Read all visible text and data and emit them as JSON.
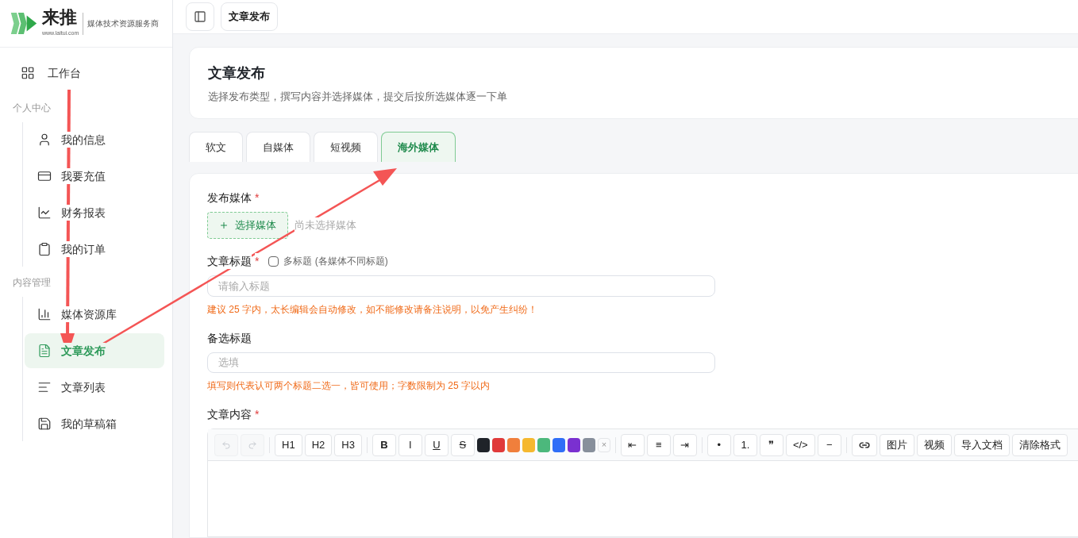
{
  "logo": {
    "name": "来推",
    "url": "www.laitui.com",
    "tagline": "媒体技术资源服务商"
  },
  "header": {
    "breadcrumb": "文章发布"
  },
  "sidebar": {
    "top": {
      "label": "工作台",
      "selected": false
    },
    "groups": [
      {
        "title": "个人中心",
        "items": [
          {
            "label": "我的信息",
            "selected": false
          },
          {
            "label": "我要充值",
            "selected": false
          },
          {
            "label": "财务报表",
            "selected": false
          },
          {
            "label": "我的订单",
            "selected": false
          }
        ]
      },
      {
        "title": "内容管理",
        "items": [
          {
            "label": "媒体资源库",
            "selected": false
          },
          {
            "label": "文章发布",
            "selected": true
          },
          {
            "label": "文章列表",
            "selected": false
          },
          {
            "label": "我的草稿箱",
            "selected": false
          }
        ]
      }
    ]
  },
  "page": {
    "title": "文章发布",
    "subtitle": "选择发布类型，撰写内容并选择媒体，提交后按所选媒体逐一下单"
  },
  "tabs": [
    {
      "label": "软文",
      "selected": false
    },
    {
      "label": "自媒体",
      "selected": false
    },
    {
      "label": "短视频",
      "selected": false
    },
    {
      "label": "海外媒体",
      "selected": true
    }
  ],
  "form": {
    "media": {
      "label": "发布媒体",
      "required_mark": "*",
      "button": "选择媒体",
      "status": "尚未选择媒体"
    },
    "title": {
      "label": "文章标题",
      "required_mark": "*",
      "checkbox": {
        "label": "多标题",
        "note": "(各媒体不同标题)",
        "checked": false
      },
      "placeholder": "请输入标题",
      "hint": "建议 25 字内，太长编辑会自动修改，如不能修改请备注说明，以免产生纠纷！"
    },
    "alt_title": {
      "label": "备选标题",
      "placeholder": "选填",
      "hint": "填写则代表认可两个标题二选一，皆可使用；字数限制为 25 字以内"
    },
    "content": {
      "label": "文章内容",
      "required_mark": "*",
      "toolbar": [
        [
          {
            "kind": "undo",
            "disabled": true
          },
          {
            "kind": "redo",
            "disabled": true
          }
        ],
        [
          {
            "kind": "text",
            "label": "H1",
            "disabled": false
          },
          {
            "kind": "text",
            "label": "H2",
            "disabled": false
          },
          {
            "kind": "text",
            "label": "H3",
            "disabled": false
          }
        ],
        [
          {
            "kind": "bold",
            "label": "B",
            "disabled": false
          },
          {
            "kind": "text",
            "label": "I",
            "disabled": false
          },
          {
            "kind": "underline",
            "label": "U",
            "disabled": false
          },
          {
            "kind": "strike",
            "label": "S",
            "disabled": false
          },
          {
            "kind": "color",
            "color": "#1f2329"
          },
          {
            "kind": "color",
            "color": "#e03a3a"
          },
          {
            "kind": "color",
            "color": "#f07f3c"
          },
          {
            "kind": "color",
            "color": "#f5b82e"
          },
          {
            "kind": "color",
            "color": "#4cb87c"
          },
          {
            "kind": "color",
            "color": "#2f6ef7"
          },
          {
            "kind": "color",
            "color": "#7a30d0"
          },
          {
            "kind": "color",
            "color": "#878f9b"
          },
          {
            "kind": "clear",
            "label": "×",
            "disabled": false
          }
        ],
        [
          {
            "kind": "text",
            "label": "⇤",
            "disabled": false
          },
          {
            "kind": "text",
            "label": "≡",
            "disabled": false
          },
          {
            "kind": "text",
            "label": "⇥",
            "disabled": false
          }
        ],
        [
          {
            "kind": "text",
            "label": "•",
            "disabled": false
          },
          {
            "kind": "text",
            "label": "1.",
            "disabled": false
          },
          {
            "kind": "text",
            "label": "❞",
            "disabled": false
          },
          {
            "kind": "text",
            "label": "</>",
            "disabled": false
          },
          {
            "kind": "text",
            "label": "−",
            "disabled": false
          }
        ],
        [
          {
            "kind": "link",
            "disabled": false
          },
          {
            "kind": "text",
            "label": "图片",
            "disabled": false
          },
          {
            "kind": "text",
            "label": "视频",
            "disabled": false
          },
          {
            "kind": "text",
            "label": "导入文档",
            "disabled": false
          },
          {
            "kind": "text",
            "label": "清除格式",
            "disabled": false
          }
        ]
      ]
    }
  }
}
